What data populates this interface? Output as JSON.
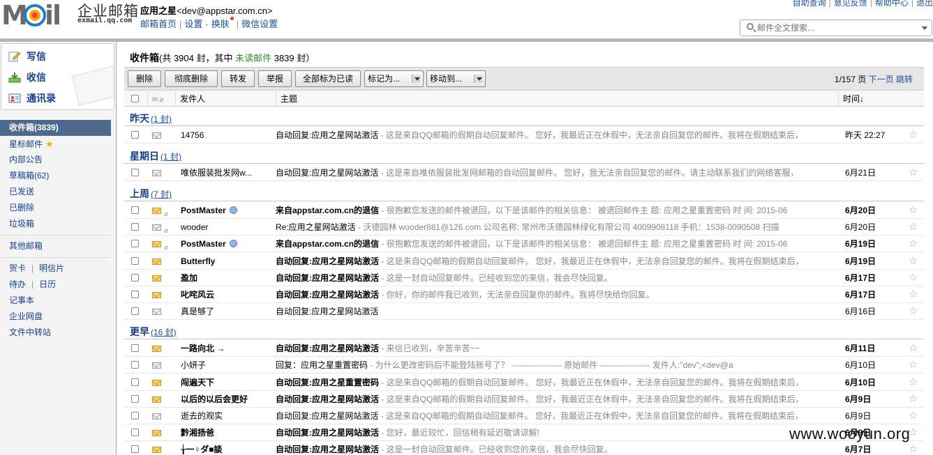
{
  "app": {
    "logo_text": "MAIL",
    "brand_cn": "企业邮箱",
    "domain": "exmail.qq.com",
    "user_name": "应用之星",
    "user_email": "<dev@appstar.com.cn>",
    "nav": [
      "邮箱首页",
      "设置",
      "换肤",
      "微信设置"
    ],
    "top_links": [
      "自助查询",
      "意见反馈",
      "帮助中心",
      "退出"
    ],
    "search_placeholder": "邮件全文搜索..."
  },
  "actions": [
    "写信",
    "收信",
    "通讯录"
  ],
  "folders": {
    "inbox": "收件箱(3839)",
    "starred": "星标邮件",
    "notice": "内部公告",
    "drafts": "草稿箱(62)",
    "sent": "已发送",
    "deleted": "已删除",
    "spam": "垃圾箱",
    "other": "其他邮箱",
    "card": "贺卡",
    "postcard": "明信片",
    "todo": "待办",
    "calendar": "日历",
    "notes": "记事本",
    "disk": "企业网盘",
    "transfer": "文件中转站"
  },
  "inbox": {
    "title": "收件箱",
    "summary_prefix": "(共 3904 封，其中 ",
    "unread_link": "未读邮件",
    "summary_suffix": " 3839 封）"
  },
  "toolbar": {
    "delete": "删除",
    "perm_delete": "彻底删除",
    "forward": "转发",
    "report": "举报",
    "mark_all_read": "全部标为已读",
    "mark_as": "标记为...",
    "move_to": "移动到...",
    "page": "1/157 页",
    "next": "下一页",
    "jump": "跳转"
  },
  "columns": {
    "sender": "发件人",
    "subject": "主题",
    "time": "时间↓"
  },
  "groups": [
    {
      "label": "昨天",
      "count": "(1 封)"
    },
    {
      "label": "星期日",
      "count": "(1 封)"
    },
    {
      "label": "上周",
      "count": "(7 封)"
    },
    {
      "label": "更早",
      "count": "(16 封)"
    }
  ],
  "emails": [
    {
      "sender": "14756",
      "subject": "自动回复:应用之星网站激活",
      "preview": " - 这是来自QQ邮箱的假期自动回复邮件。 您好，我最近正在休假中，无法亲自回复您的邮件。我将在假期结束后，",
      "time": "昨天 22:27",
      "unread": false
    },
    {
      "sender": "唯依服装批发网w...",
      "subject": "自动回复:应用之星网站激活",
      "preview": " - 这是来自唯依服装批发网邮箱的自动回复邮件。 您好，我无法亲自回复您的邮件。请主动联系我们的网络客服，",
      "time": "6月21日",
      "unread": false
    },
    {
      "sender": "PostMaster",
      "subject": "来自appstar.com.cn的退信",
      "preview": " - 很抱歉您发送的邮件被退回，以下是该邮件的相关信息： 被退回邮件主 题: 应用之星重置密码 时 间: 2015-06",
      "time": "6月20日",
      "unread": true
    },
    {
      "sender": "wooder",
      "subject": "Re:应用之星网站激活",
      "preview": " - 沃德园林 wooder881@126.com 公司名称: 常州市沃德园林绿化有限公司 4009908118 手机：1538-0090508 扫描",
      "time": "6月20日",
      "unread": false
    },
    {
      "sender": "PostMaster",
      "subject": "来自appstar.com.cn的退信",
      "preview": " - 很抱歉您发送的邮件被退回，以下是该邮件的相关信息： 被退回邮件主 题: 应用之星重置密码 时 间: 2015-06",
      "time": "6月19日",
      "unread": true
    },
    {
      "sender": "Butterfly",
      "subject": "自动回复:应用之星网站激活",
      "preview": " - 这是来自QQ邮箱的假期自动回复邮件。 您好，我最近正在休假中，无法亲自回复您的邮件。我将在假期结束后，",
      "time": "6月19日",
      "unread": true
    },
    {
      "sender": "盈加",
      "subject": "自动回复:应用之星网站激活",
      "preview": " - 这是一封自动回复邮件。已经收到您的来信，我会尽快回复。",
      "time": "6月17日",
      "unread": true
    },
    {
      "sender": "叱咤风云",
      "subject": "自动回复:应用之星网站激活",
      "preview": " - 你好，你的邮件我已收到，无法亲自回复你的邮件。我将尽快给你回复。",
      "time": "6月17日",
      "unread": true
    },
    {
      "sender": "真是够了",
      "subject": "自动回复:应用之星网站激活",
      "preview": "",
      "time": "6月16日",
      "unread": false
    },
    {
      "sender": "一路向北 →",
      "subject": "自动回复:应用之星网站激活",
      "preview": " - 来信已收到，辛苦辛苦~~",
      "time": "6月11日",
      "unread": true
    },
    {
      "sender": "小妍子",
      "subject": "回复：应用之星重置密码",
      "preview": " - 为什么更改密码后不能登陆账号了？ ------------------ 原始邮件 ------------------ 发件人:\"dev\";<dev@a",
      "time": "6月10日",
      "unread": false
    },
    {
      "sender": "闯遍天下",
      "subject": "自动回复:应用之星重置密码",
      "preview": " - 这是来自QQ邮箱的假期自动回复邮件。 您好，我最近正在休假中，无法亲自回复您的邮件。我将在假期结束后，",
      "time": "6月10日",
      "unread": true
    },
    {
      "sender": "以后的以后会更好",
      "subject": "自动回复:应用之星网站激活",
      "preview": " - 这是来自QQ邮箱的假期自动回复邮件。 您好，我最近正在休假中，无法亲自回复您的邮件。我将在假期结束后，",
      "time": "6月9日",
      "unread": true
    },
    {
      "sender": "逝去的观实",
      "subject": "自动回复:应用之星网站激活",
      "preview": " - 这是来自QQ邮箱的假期自动回复邮件。 您好，我最近正在休假中，无法亲自回复您的邮件。我将在假期结束后，",
      "time": "6月9日",
      "unread": false
    },
    {
      "sender": "黔湘扬爸",
      "subject": "自动回复:应用之星网站激活",
      "preview": " - 您好，最近较忙，回信稍有延迟敬请谅解!",
      "time": "6月9日",
      "unread": true
    },
    {
      "sender": "╁一♀ダ■談",
      "subject": "自动回复:应用之星网站激活",
      "preview": " - 这是一封自动回复邮件。已经收到您的来信，我会尽快回复。",
      "time": "6月7日",
      "unread": true
    }
  ],
  "watermark": "www.wooyun.org",
  "colors": {
    "link": "#1e4f9c",
    "active_folder": "#4d6a8c",
    "unread_env": "#f9d56b"
  }
}
